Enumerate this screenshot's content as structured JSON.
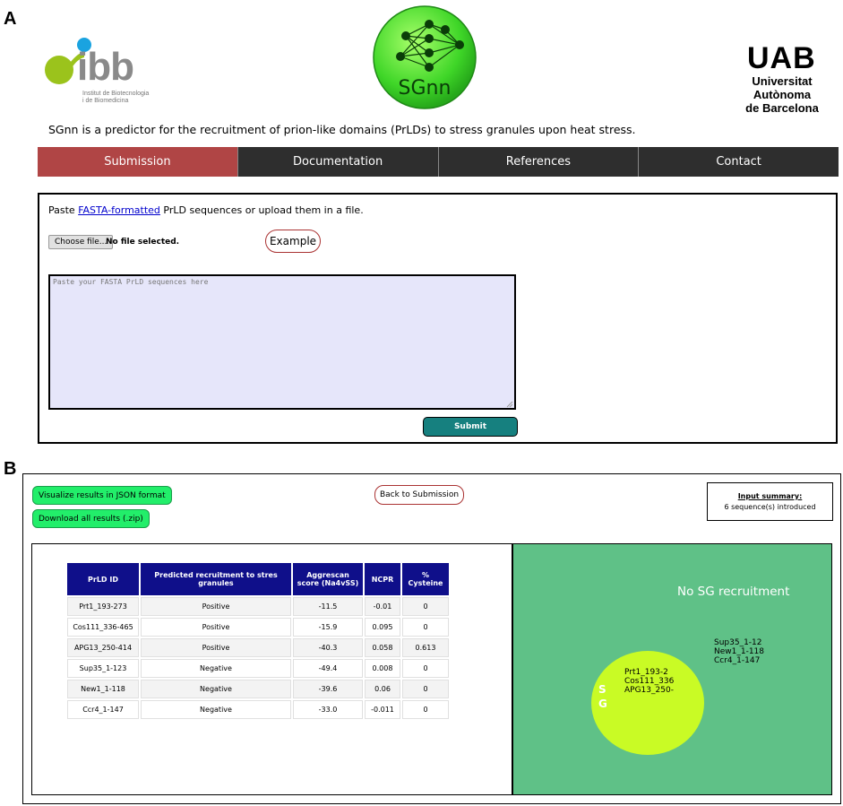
{
  "panels": {
    "a": "A",
    "b": "B"
  },
  "logos": {
    "ibb_text": "ibb",
    "ibb_sub_1": "Institut de Biotecnologia",
    "ibb_sub_2": "i de Biomedicina",
    "sgnn_text": "SGnn",
    "uab_text": "UAB",
    "uab_sub_1": "Universitat Autònoma",
    "uab_sub_2": "de Barcelona"
  },
  "intro": "SGnn is a predictor for the recruitment of prion-like domains (PrLDs) to stress granules upon heat stress.",
  "nav": {
    "tabs": [
      "Submission",
      "Documentation",
      "References",
      "Contact"
    ]
  },
  "form": {
    "paste_pre": "Paste ",
    "paste_link": "FASTA-formatted",
    "paste_post": " PrLD sequences or upload them in a file.",
    "file_button": "Choose file...",
    "file_status": "No file selected.",
    "example": "Example",
    "placeholder": "Paste your FASTA PrLD sequences here",
    "submit": "Submit"
  },
  "results": {
    "json_button": "Visualize results in JSON format",
    "zip_button": "Download all results (.zip)",
    "back_button": "Back to Submission",
    "summary_title": "Input summary:",
    "summary_count": "6 sequence(s) introduced",
    "headers": [
      "PrLD ID",
      "Predicted recruitment to stres granules",
      "Aggrescan score (Na4vSS)",
      "NCPR",
      "% Cysteine"
    ],
    "rows": [
      [
        "Prt1_193-273",
        "Positive",
        "-11.5",
        "-0.01",
        "0"
      ],
      [
        "Cos111_336-465",
        "Positive",
        "-15.9",
        "0.095",
        "0"
      ],
      [
        "APG13_250-414",
        "Positive",
        "-40.3",
        "0.058",
        "0.613"
      ],
      [
        "Sup35_1-123",
        "Negative",
        "-49.4",
        "0.008",
        "0"
      ],
      [
        "New1_1-118",
        "Negative",
        "-39.6",
        "0.06",
        "0"
      ],
      [
        "Ccr4_1-147",
        "Negative",
        "-33.0",
        "-0.011",
        "0"
      ]
    ],
    "venn": {
      "outside_label": "No SG recruitment",
      "outside_items": [
        "Sup35_1-12",
        "New1_1-118",
        "Ccr4_1-147"
      ],
      "inside_label_1": "S",
      "inside_label_2": "G",
      "inside_items": [
        "Prt1_193-2",
        "Cos111_336",
        "APG13_250-"
      ]
    }
  },
  "colors": {
    "nav_active": "#b04545",
    "nav_bg": "#2e2e2e",
    "submit": "#16807f",
    "green_button": "#22ee6a",
    "table_header": "#0f0f8a",
    "venn_bg": "#5fc187",
    "sg_circle": "#c9fb25"
  }
}
